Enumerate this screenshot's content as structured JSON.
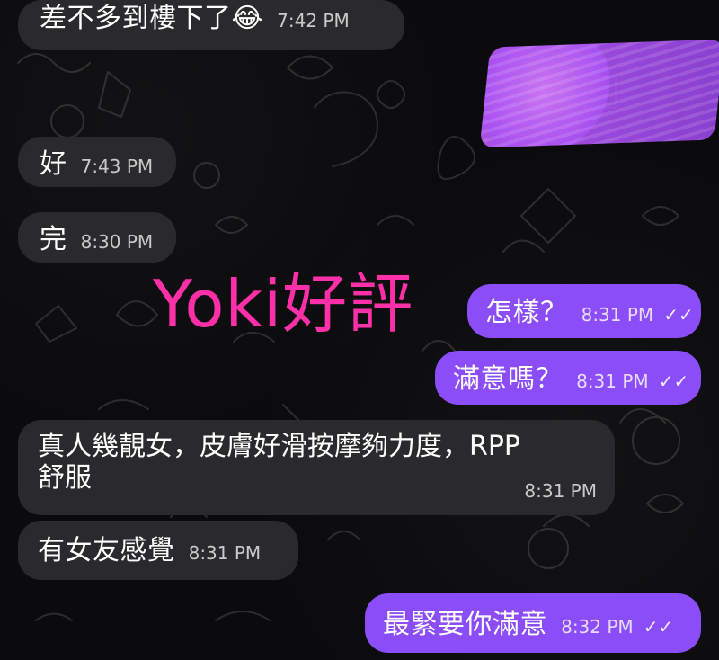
{
  "watermark": {
    "text": "Yoki好評"
  },
  "messages": [
    {
      "side": "incoming",
      "text": "差不多到樓下了😂",
      "time": "7:42 PM"
    },
    {
      "side": "incoming",
      "text": "好",
      "time": "7:43 PM"
    },
    {
      "side": "incoming",
      "text": "完",
      "time": "8:30 PM"
    },
    {
      "side": "outgoing",
      "text": "怎樣？",
      "time": "8:31 PM"
    },
    {
      "side": "outgoing",
      "text": "滿意嗎？",
      "time": "8:31 PM"
    },
    {
      "side": "incoming",
      "text_line_1": "真人幾靚女，皮膚好滑按摩夠力度，RPP",
      "text_line_2": "舒服",
      "time": "8:31 PM"
    },
    {
      "side": "incoming",
      "text": "有女友感覺",
      "time": "8:31 PM"
    },
    {
      "side": "outgoing",
      "text": "最緊要你滿意",
      "time": "8:32 PM"
    }
  ]
}
